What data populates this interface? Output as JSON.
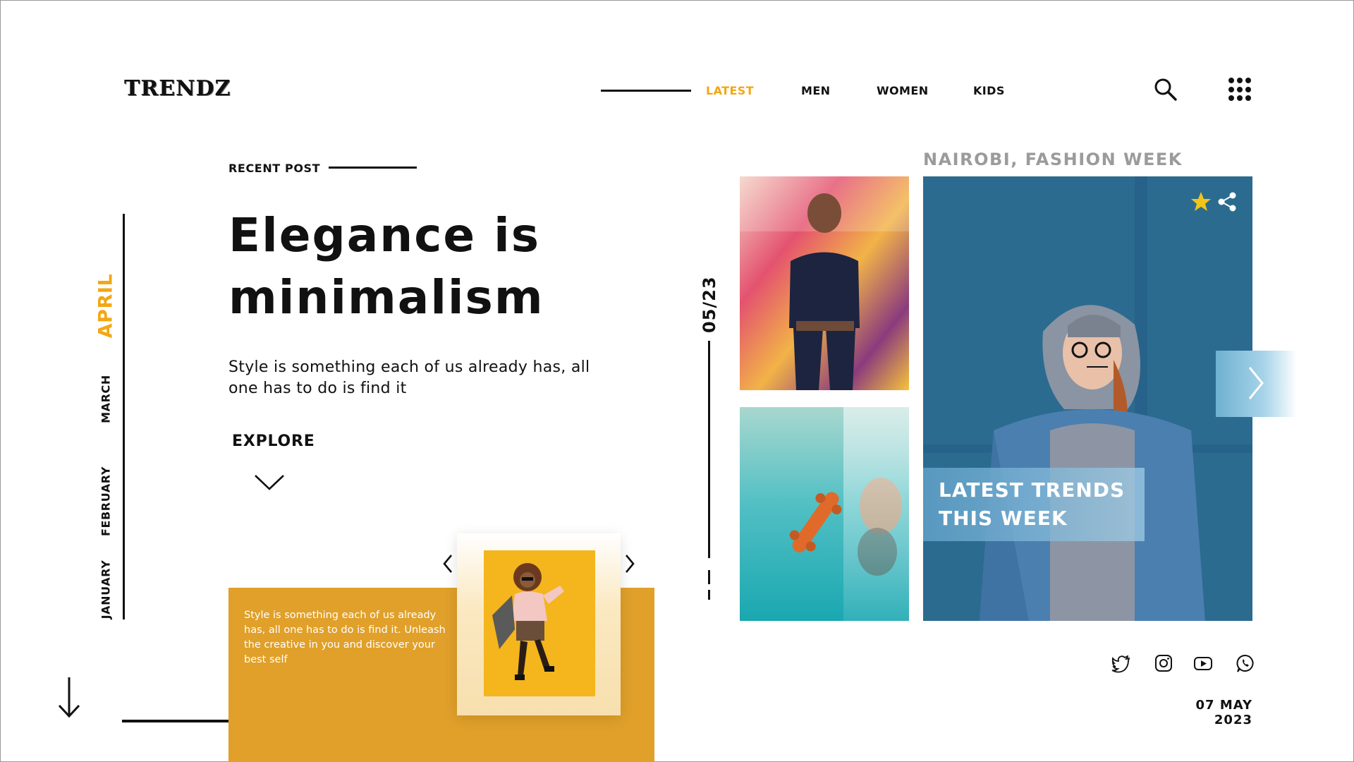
{
  "header": {
    "logo": "TRENDZ",
    "nav": [
      {
        "label": "LATEST",
        "active": true
      },
      {
        "label": "MEN",
        "active": false
      },
      {
        "label": "WOMEN",
        "active": false
      },
      {
        "label": "KIDS",
        "active": false
      }
    ],
    "icons": [
      "search-icon",
      "apps-grid-icon"
    ]
  },
  "timeline": {
    "months": [
      "APRIL",
      "MARCH",
      "FEBRUARY",
      "JANUARY"
    ],
    "active_month": "APRIL"
  },
  "post": {
    "section_label": "RECENT POST",
    "headline_line1": "Elegance is",
    "headline_line2": "minimalism",
    "subtext": "Style is something each of us already has, all one has to do is find it",
    "explore_label": "EXPLORE"
  },
  "card": {
    "text": "Style is something each of us already has, all one has to do is find it. Unleash the creative in you and discover your best self"
  },
  "gallery": {
    "counter": "05/23",
    "event_label": "NAIROBI, FASHION WEEK",
    "banner_line1": "LATEST TRENDS",
    "banner_line2": "THIS WEEK"
  },
  "social": [
    "twitter-icon",
    "instagram-icon",
    "youtube-icon",
    "whatsapp-icon"
  ],
  "footer": {
    "date": "07 MAY 2023"
  },
  "colors": {
    "accent": "#f2a713",
    "card_yellow": "#e0a02a",
    "muted": "#9b9b9b",
    "main_image_blue": "#2a6a8f"
  }
}
